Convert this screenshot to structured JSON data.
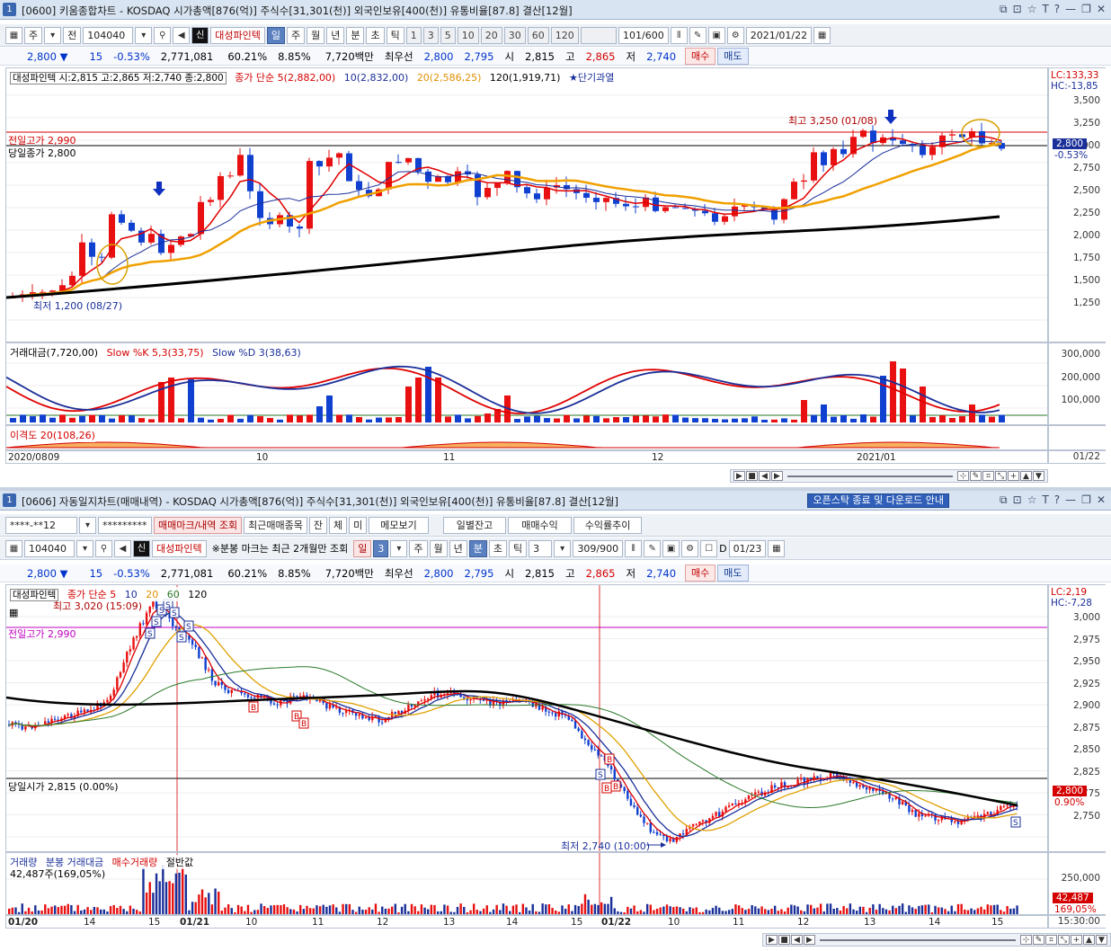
{
  "top": {
    "window_num": "1",
    "title": "[0600] 키움종합차트 - KOSDAQ 시가총액[876(억)] 주식수[31,301(천)] 외국인보유[400(천)] 유통비율[87.8] 결산[12월]",
    "window_buttons": [
      "⧉",
      "⊡",
      "☆",
      "T",
      "?",
      "—",
      "❐",
      "✕"
    ],
    "toolbar": {
      "type1": "주",
      "type2": "전",
      "code": "104040",
      "sin": "신",
      "name": "대성파인텍",
      "periods": [
        "일",
        "주",
        "월",
        "년",
        "분",
        "초",
        "틱"
      ],
      "selected_period": "일",
      "intervals": [
        "1",
        "3",
        "5",
        "10",
        "20",
        "30",
        "60",
        "120"
      ],
      "count": "101/600",
      "date": "2021/01/22"
    },
    "quote": {
      "price": "2,800",
      "arrow": "▼",
      "change": "15",
      "pct": "-0.53%",
      "volume": "2,771,081",
      "ratio": "60.21%",
      "turnover": "8.85%",
      "amount": "7,720백만",
      "best_label": "최우선",
      "best_sell": "2,800",
      "best_buy": "2,795",
      "open_label": "시",
      "open": "2,815",
      "high_label": "고",
      "high": "2,865",
      "low_label": "저",
      "low": "2,740",
      "buy": "매수",
      "sell": "매도"
    },
    "legend": {
      "info": "대성파인텍 시:2,815 고:2,865 저:2,740 종:2,800",
      "ma_label": "종가 단순 5(2,882,00)",
      "ma10": "10(2,832,00)",
      "ma20": "20(2,586,25)",
      "ma120": "120(1,919,71)",
      "star": "★단기과열"
    },
    "labels": {
      "prev_high": "전일고가 2,990",
      "prev_close": "당일종가 2,800",
      "max": "최고 3,250 (01/08)",
      "min": "최저 1,200 (08/27)",
      "lc": "LC:133,33",
      "hc": "HC:-13,85",
      "cur_price": "2,800",
      "cur_pct": "-0.53%"
    },
    "price_ticks": [
      "3,500",
      "3,250",
      "3,000",
      "2,750",
      "2,500",
      "2,250",
      "2,000",
      "1,750",
      "1,500",
      "1,250"
    ],
    "sub_legend": {
      "vol": "거래대금(7,720,00)",
      "k": "Slow %K 5,3(33,75)",
      "d": "Slow %D 3(38,63)"
    },
    "vol_ticks": [
      "300,000",
      "200,000",
      "100,000"
    ],
    "disparity": "이격도 20(108,26)",
    "x_labels": [
      "2020/08",
      "09",
      "10",
      "11",
      "12",
      "2021/01"
    ],
    "x_right": "01/22"
  },
  "bottom": {
    "window_num": "1",
    "title": "[0606] 자동일지차트(매매내역) - KOSDAQ 시가총액[876(억)] 주식수[31,301(천)] 외국인보유[400(천)] 유통비율[87.8] 결산[12월]",
    "notice": "오픈스탁 종료 및 다운로드 안내",
    "window_buttons": [
      "⧉",
      "⊡",
      "☆",
      "T",
      "?",
      "—",
      "❐",
      "✕"
    ],
    "toolbar1": {
      "account": "****-**12",
      "password": "*********",
      "btn1": "매매마크/내역 조회",
      "btn2": "최근매매종목",
      "btn3": "잔",
      "btn4": "체",
      "btn5": "미",
      "btn6": "메모보기",
      "btn7": "일별잔고",
      "btn8": "매매수익",
      "btn9": "수익률추이"
    },
    "toolbar2": {
      "code": "104040",
      "sin": "신",
      "name": "대성파인텍",
      "note": "※분봉 마크는 최근 2개월만 조회",
      "periods": [
        "일",
        "3",
        "주",
        "월",
        "년",
        "분",
        "초",
        "틱"
      ],
      "selected_period": "분",
      "minute": "3",
      "count": "309/900",
      "d_label": "D",
      "date": "01/23"
    },
    "quote": {
      "price": "2,800",
      "arrow": "▼",
      "change": "15",
      "pct": "-0.53%",
      "volume": "2,771,081",
      "ratio": "60.21%",
      "turnover": "8.85%",
      "amount": "7,720백만",
      "best_label": "최우선",
      "best_sell": "2,800",
      "best_buy": "2,795",
      "open_label": "시",
      "open": "2,815",
      "high_label": "고",
      "high": "2,865",
      "low_label": "저",
      "low": "2,740",
      "buy": "매수",
      "sell": "매도"
    },
    "legend": {
      "name": "대성파인텍",
      "ma": "종가 단순 5",
      "ma10": "10",
      "ma20": "20",
      "ma60": "60",
      "ma120": "120"
    },
    "labels": {
      "max": "최고 3,020 (15:09)",
      "min": "최저 2,740 (10:00)",
      "prev_high": "전일고가 2,990",
      "open_today": "당일시가 2,815 (0.00%)",
      "lc": "LC:2,19",
      "hc": "HC:-7,28",
      "cur_price": "2,800",
      "cur_pct": "0.90%"
    },
    "price_ticks": [
      "3,000",
      "2,975",
      "2,950",
      "2,925",
      "2,900",
      "2,875",
      "2,850",
      "2,825",
      "2,775",
      "2,750"
    ],
    "vol_legend": {
      "v1": "거래량",
      "v2": "분봉 거래대금",
      "v3": "매수거래량",
      "v4": "절반값",
      "v5": "42,487주(169,05%)"
    },
    "vol_ticks": [
      "250,000"
    ],
    "vol_box": "42,487",
    "vol_pct": "169,05%",
    "x_labels": [
      "01/20",
      "14",
      "15",
      "01/21",
      "10",
      "11",
      "12",
      "13",
      "14",
      "15",
      "01/22",
      "10",
      "11",
      "12",
      "13",
      "14",
      "15"
    ],
    "x_right": "15:30:00"
  }
}
